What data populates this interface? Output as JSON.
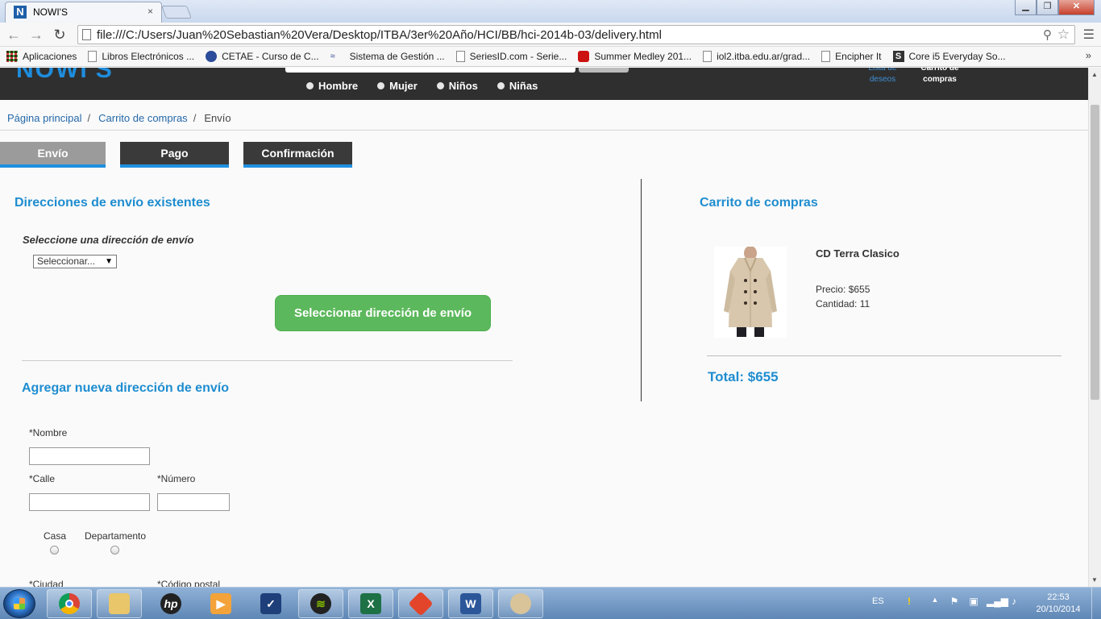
{
  "browser": {
    "tab_title": "NOWI'S",
    "tab_favicon": "N",
    "tab_close": "×",
    "url": "file:///C:/Users/Juan%20Sebastian%20Vera/Desktop/ITBA/3er%20Año/HCI/BB/hci-2014b-03/delivery.html",
    "bookmarks": [
      {
        "label": "Aplicaciones",
        "icon": "apps-icon"
      },
      {
        "label": "Libros Electrónicos ...",
        "icon": "page-icon"
      },
      {
        "label": "CETAE - Curso de C...",
        "icon": "globe-icon"
      },
      {
        "label": "Sistema de Gestión ...",
        "icon": "wave-icon"
      },
      {
        "label": "SeriesID.com - Serie...",
        "icon": "page-icon"
      },
      {
        "label": "Summer Medley 201...",
        "icon": "youtube-icon"
      },
      {
        "label": "iol2.itba.edu.ar/grad...",
        "icon": "page-icon"
      },
      {
        "label": "Encipher It",
        "icon": "page-icon"
      },
      {
        "label": "Core i5 Everyday So...",
        "icon": "s-icon"
      }
    ],
    "bookmarks_more": "»"
  },
  "site": {
    "categories": [
      "Hombre",
      "Mujer",
      "Niños",
      "Niñas"
    ],
    "wishlist_label": "Lista de deseos",
    "cart_label": "Carrito de compras"
  },
  "breadcrumb": {
    "home": "Página principal",
    "cart": "Carrito de compras",
    "current": "Envío",
    "separator": "/"
  },
  "steps": [
    "Envío",
    "Pago",
    "Confirmación"
  ],
  "shipping": {
    "existing_title": "Direcciones de envío existentes",
    "select_label": "Seleccione una dirección de envío",
    "select_value": "Seleccionar...",
    "select_button": "Seleccionar dirección de envío",
    "new_title": "Agregar nueva dirección de envío",
    "fields": {
      "nombre": "*Nombre",
      "calle": "*Calle",
      "numero": "*Número",
      "casa": "Casa",
      "departamento": "Departamento",
      "ciudad": "*Ciudad",
      "codigo_postal": "*Código postal"
    }
  },
  "cart": {
    "title": "Carrito de compras",
    "product_name": "CD Terra Clasico",
    "price_label": "Precio:",
    "price_value": "$655",
    "qty_label": "Cantidad:",
    "qty_value": "11",
    "total_label": "Total:",
    "total_value": "$655"
  },
  "taskbar": {
    "language": "ES",
    "time": "22:53",
    "date": "20/10/2014"
  },
  "colors": {
    "accent_blue": "#1e8dd0",
    "button_green": "#5cb85c",
    "header_dark": "#2f2f2f"
  }
}
